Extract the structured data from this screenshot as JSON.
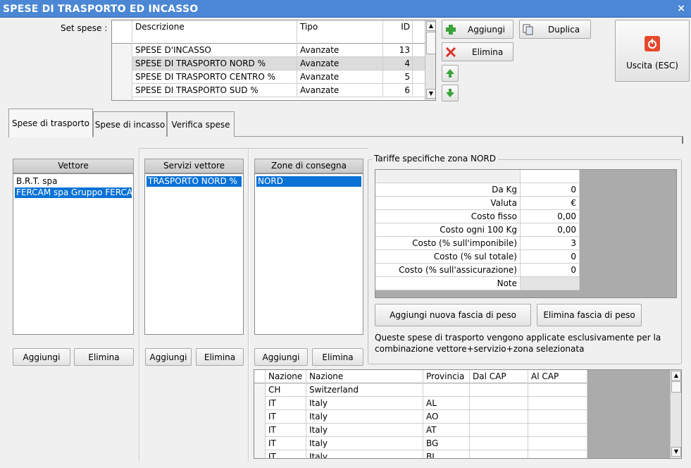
{
  "window": {
    "title": "SPESE DI TRASPORTO ED INCASSO",
    "close_label": "×"
  },
  "setspese": {
    "label": "Set spese :",
    "columns": [
      "Descrizione",
      "Tipo",
      "ID"
    ],
    "rows": [
      {
        "descrizione": "SPESE D'INCASSO",
        "tipo": "Avanzate",
        "id": "13"
      },
      {
        "descrizione": "SPESE DI TRASPORTO NORD %",
        "tipo": "Avanzate",
        "id": "4"
      },
      {
        "descrizione": "SPESE DI TRASPORTO CENTRO %",
        "tipo": "Avanzate",
        "id": "5"
      },
      {
        "descrizione": "SPESE DI TRASPORTO SUD %",
        "tipo": "Avanzate",
        "id": "6"
      }
    ]
  },
  "toolbar": {
    "aggiungi": "Aggiungi",
    "elimina": "Elimina",
    "duplica": "Duplica",
    "uscita": "Uscita (ESC)"
  },
  "tabs": [
    "Spese di trasporto",
    "Spese di incasso",
    "Verifica spese"
  ],
  "vettore": {
    "header": "Vettore",
    "items": [
      "B.R.T. spa",
      "FERCAM spa Gruppo FERCAM"
    ],
    "aggiungi": "Aggiungi",
    "elimina": "Elimina"
  },
  "servizi": {
    "header": "Servizi vettore",
    "items": [
      "TRASPORTO NORD %"
    ],
    "aggiungi": "Aggiungi",
    "elimina": "Elimina"
  },
  "zone": {
    "header": "Zone di consegna",
    "items": [
      "NORD"
    ],
    "aggiungi": "Aggiungi",
    "elimina": "Elimina"
  },
  "tariffe": {
    "title": "Tariffe specifiche zona NORD",
    "rows": [
      {
        "label": "Da Kg",
        "value": "0"
      },
      {
        "label": "Valuta",
        "value": "€"
      },
      {
        "label": "Costo fisso",
        "value": "0,00"
      },
      {
        "label": "Costo ogni 100 Kg",
        "value": "0,00"
      },
      {
        "label": "Costo (% sull'imponibile)",
        "value": "3"
      },
      {
        "label": "Costo (% sul totale)",
        "value": "0"
      },
      {
        "label": "Costo (% sull'assicurazione)",
        "value": "0"
      },
      {
        "label": "Note",
        "value": ""
      }
    ],
    "aggiungi_fascia": "Aggiungi nuova fascia di peso",
    "elimina_fascia": "Elimina fascia di peso",
    "note_line1": "Queste spese di trasporto vengono applicate esclusivamente per la",
    "note_line2": "combinazione vettore+servizio+zona selezionata"
  },
  "nazioni": {
    "columns": [
      "Nazione",
      "Nazione",
      "Provincia",
      "Dal CAP",
      "Al CAP"
    ],
    "rows": [
      {
        "code": "CH",
        "name": "Switzerland",
        "prov": "",
        "dal": "",
        "al": ""
      },
      {
        "code": "IT",
        "name": "Italy",
        "prov": "AL",
        "dal": "",
        "al": ""
      },
      {
        "code": "IT",
        "name": "Italy",
        "prov": "AO",
        "dal": "",
        "al": ""
      },
      {
        "code": "IT",
        "name": "Italy",
        "prov": "AT",
        "dal": "",
        "al": ""
      },
      {
        "code": "IT",
        "name": "Italy",
        "prov": "BG",
        "dal": "",
        "al": ""
      },
      {
        "code": "IT",
        "name": "Italy",
        "prov": "BI",
        "dal": "",
        "al": ""
      }
    ]
  },
  "colors": {
    "titlebar": "#4b87d4",
    "selection": "#0a72d6",
    "grid_empty": "#ababab"
  }
}
